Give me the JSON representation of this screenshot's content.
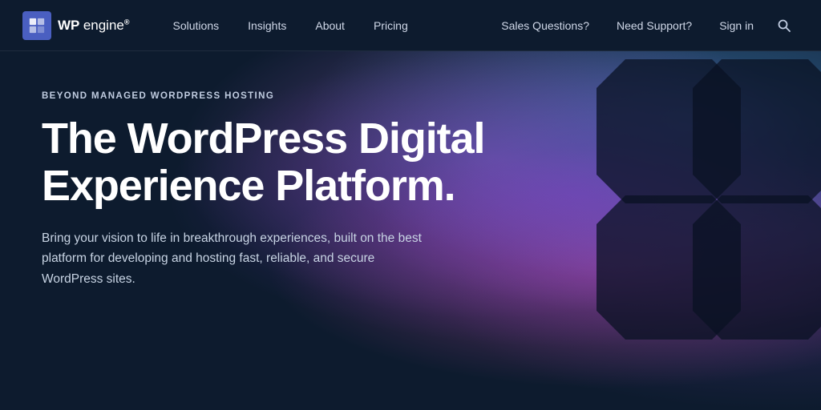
{
  "brand": {
    "logo_alt": "WP Engine",
    "logo_text": "WP",
    "logo_suffix": "engine",
    "trademark": "®"
  },
  "nav": {
    "links": [
      {
        "label": "Solutions",
        "id": "solutions"
      },
      {
        "label": "Insights",
        "id": "insights"
      },
      {
        "label": "About",
        "id": "about"
      },
      {
        "label": "Pricing",
        "id": "pricing"
      }
    ],
    "right_links": [
      {
        "label": "Sales Questions?",
        "id": "sales"
      },
      {
        "label": "Need Support?",
        "id": "support"
      },
      {
        "label": "Sign in",
        "id": "signin"
      }
    ],
    "search_label": "Search"
  },
  "hero": {
    "eyebrow": "BEYOND MANAGED WORDPRESS HOSTING",
    "title_line1": "The WordPress Digital",
    "title_line2": "Experience Platform.",
    "description": "Bring your vision to life in breakthrough experiences, built on the best platform for developing and hosting fast, reliable, and secure WordPress sites."
  },
  "colors": {
    "bg_dark": "#0d1b2e",
    "accent_blue": "#4a5fc1",
    "text_light": "#d0d8e8"
  }
}
